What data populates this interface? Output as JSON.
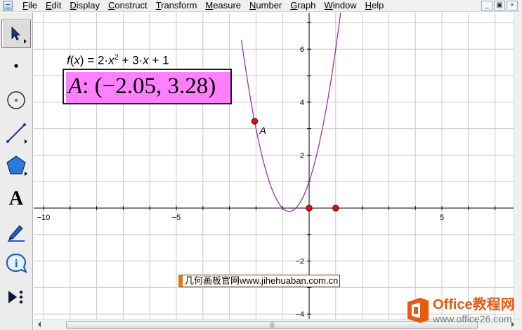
{
  "menu": {
    "items": [
      "File",
      "Edit",
      "Display",
      "Construct",
      "Transform",
      "Measure",
      "Number",
      "Graph",
      "Window",
      "Help"
    ],
    "mnemonics": [
      "F",
      "E",
      "D",
      "C",
      "T",
      "M",
      "N",
      "G",
      "W",
      "H"
    ]
  },
  "window_controls": {
    "minimize": "_",
    "restore": "▣",
    "close": "×"
  },
  "tools": [
    {
      "name": "arrow-tool",
      "icon": "arrow-select-icon"
    },
    {
      "name": "point-tool",
      "icon": "point-icon"
    },
    {
      "name": "compass-tool",
      "icon": "circle-icon"
    },
    {
      "name": "straightedge-tool",
      "icon": "segment-icon"
    },
    {
      "name": "polygon-tool",
      "icon": "polygon-icon"
    },
    {
      "name": "text-tool",
      "icon": "text-icon",
      "label": "A"
    },
    {
      "name": "marker-tool",
      "icon": "pen-icon"
    },
    {
      "name": "information-tool",
      "icon": "info-icon",
      "label": "i"
    },
    {
      "name": "custom-tool",
      "icon": "custom-tool-icon"
    }
  ],
  "graph": {
    "function_label": {
      "f": "f",
      "x": "x",
      "eq": " = 2·",
      "x2": "x",
      "sup": "2",
      "rest": " + 3·",
      "x3": "x",
      "tail": " + 1"
    },
    "measurement": {
      "point": "A",
      "text": ": (−2.05, 3.28)"
    },
    "point_label": "A",
    "x_ticks": [
      "−10",
      "−5",
      "5"
    ],
    "y_ticks": [
      "6",
      "4",
      "2",
      "−2",
      "−4"
    ],
    "colors": {
      "curve": "#9933aa",
      "point": "#e01010",
      "grid": "#c8c8c8",
      "axis": "#000000",
      "measure_bg": "#ff80ff"
    }
  },
  "chart_data": {
    "type": "line",
    "title": "",
    "function": "f(x) = 2x^2 + 3x + 1",
    "series": [
      {
        "name": "f(x)",
        "x": [
          -2.05,
          -1.5,
          -1.0,
          -0.75,
          -0.5,
          0,
          0.5,
          1.0
        ],
        "y": [
          3.28,
          1.0,
          0.0,
          -0.125,
          0.0,
          1.0,
          3.0,
          6.0
        ]
      }
    ],
    "points": [
      {
        "label": "A",
        "x": -2.05,
        "y": 3.28
      },
      {
        "label": "",
        "x": 0,
        "y": 0
      },
      {
        "label": "",
        "x": 1,
        "y": 0
      }
    ],
    "xlim": [
      -10,
      5
    ],
    "ylim": [
      -4,
      6
    ],
    "grid": true
  },
  "scrollbar": {
    "grip": "|||"
  },
  "watermarks": {
    "site": "几何画板官网www.jihehuaban.com.cn",
    "office_title": "Office教程网",
    "office_url": "www.office26.com"
  }
}
